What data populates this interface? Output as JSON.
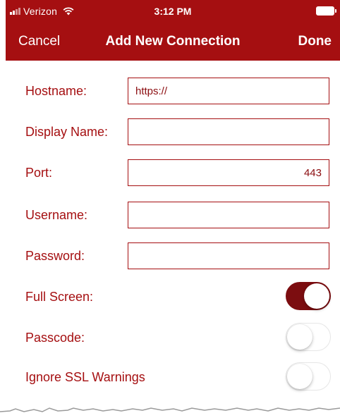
{
  "status": {
    "carrier": "Verizon",
    "time": "3:12 PM"
  },
  "nav": {
    "cancel_label": "Cancel",
    "title": "Add New Connection",
    "done_label": "Done"
  },
  "fields": [
    {
      "label": "Hostname:",
      "value": "https://"
    },
    {
      "label": "Display Name:",
      "value": ""
    },
    {
      "label": "Port:",
      "value": "443"
    },
    {
      "label": "Username:",
      "value": ""
    },
    {
      "label": "Password:",
      "value": ""
    }
  ],
  "toggles": [
    {
      "label": "Full Screen:",
      "on": true
    },
    {
      "label": "Passcode:",
      "on": false
    },
    {
      "label": "Ignore SSL Warnings",
      "on": false
    }
  ],
  "colors": {
    "accent": "#a50f11",
    "toggle_on": "#7c0d10"
  },
  "icons": [
    "signal-icon",
    "wifi-icon",
    "battery-icon"
  ]
}
